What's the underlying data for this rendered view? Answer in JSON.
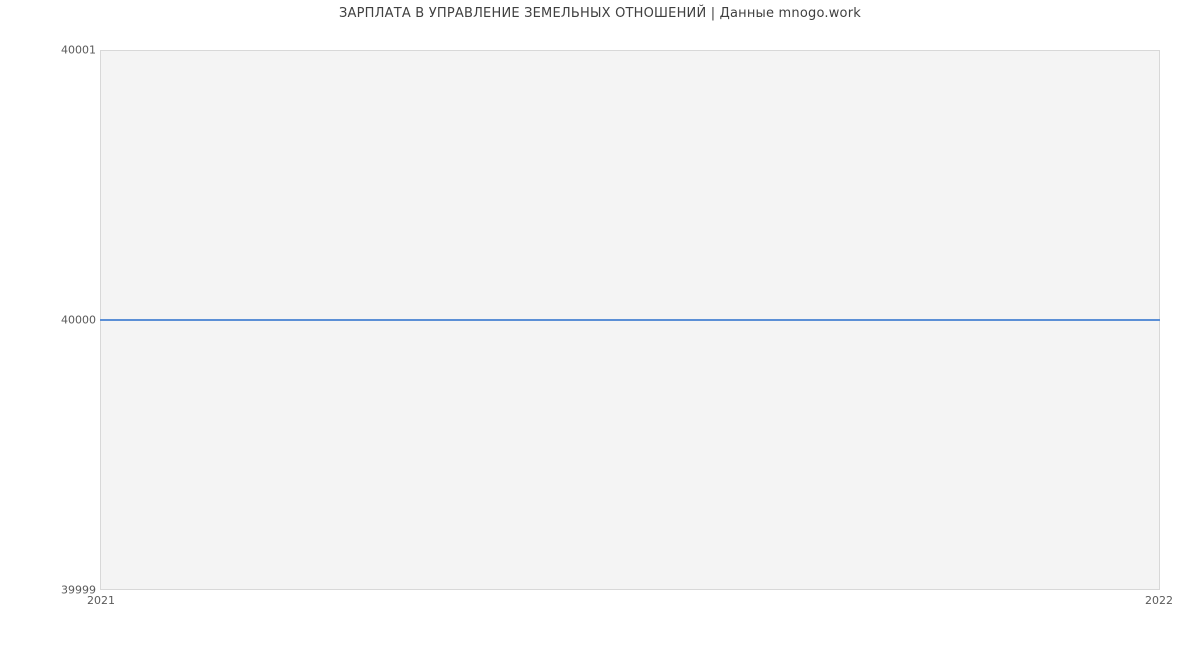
{
  "chart_data": {
    "type": "line",
    "title": "ЗАРПЛАТА В УПРАВЛЕНИЕ ЗЕМЕЛЬНЫХ ОТНОШЕНИЙ | Данные mnogo.work",
    "xlabel": "",
    "ylabel": "",
    "x": [
      "2021",
      "2022"
    ],
    "values": [
      40000,
      40000
    ],
    "ylim": [
      39999,
      40001
    ],
    "y_ticks": [
      "40001",
      "40000",
      "39999"
    ],
    "x_ticks": [
      "2021",
      "2022"
    ],
    "series_color": "#5b8fd6",
    "plot_bg": "#f4f4f4"
  }
}
